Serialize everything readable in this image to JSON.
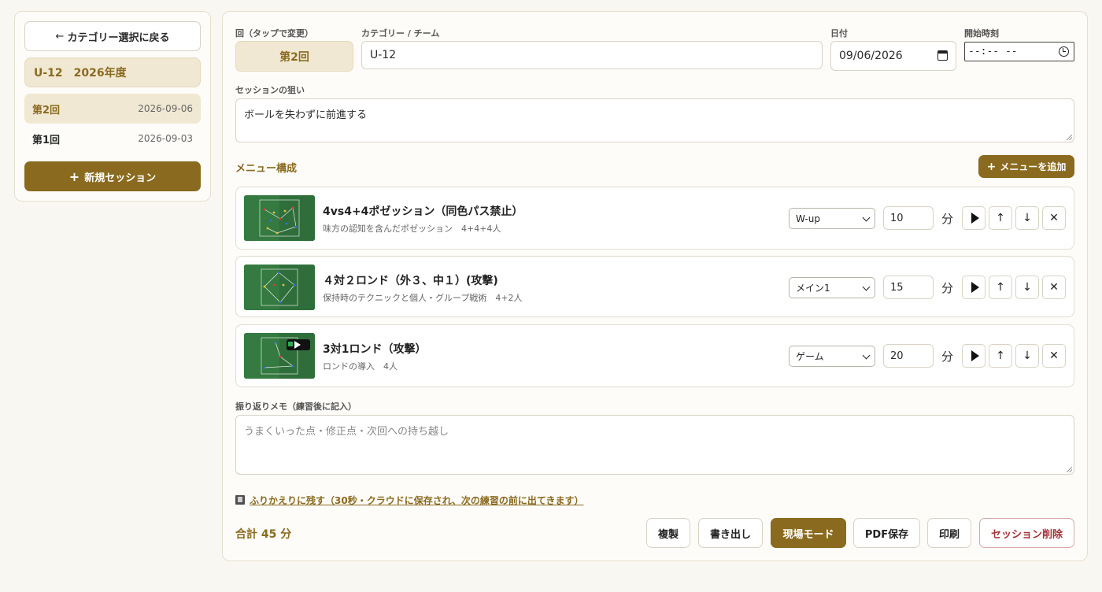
{
  "sidebar": {
    "back_label": "カテゴリー選択に戻る",
    "category_title": "U-12　2026年度",
    "sessions": [
      {
        "label": "第2回",
        "date": "2026-09-06"
      },
      {
        "label": "第1回",
        "date": "2026-09-03"
      }
    ],
    "new_session_label": "新規セッション"
  },
  "form": {
    "round_label": "回（タップで変更）",
    "round_value": "第2回",
    "category_label": "カテゴリー / チーム",
    "category_value": "U-12",
    "date_label": "日付",
    "date_value": "09/06/2026",
    "time_label": "開始時刻",
    "time_value": "--:-- --",
    "aim_label": "セッションの狙い",
    "aim_value": "ボールを失わずに前進する"
  },
  "menu": {
    "section_title": "メニュー構成",
    "add_label": "メニューを追加",
    "minutes_unit": "分",
    "items": [
      {
        "title": "4vs4+4ポゼッション（同色パス禁止）",
        "subtitle": "味方の認知を含んだポゼッション　4+4+4人",
        "phase": "W-up",
        "minutes": "10"
      },
      {
        "title": "４対２ロンド（外３、中１）(攻撃)",
        "subtitle": "保持時のテクニックと個人・グループ戦術　4+2人",
        "phase": "メイン1",
        "minutes": "15"
      },
      {
        "title": "3対1ロンド（攻撃）",
        "subtitle": "ロンドの導入　4人",
        "phase": "ゲーム",
        "minutes": "20"
      }
    ]
  },
  "reflection": {
    "label": "振り返りメモ（練習後に記入）",
    "placeholder": "うまくいった点・修正点・次回への持ち越し"
  },
  "save_link": "ふりかえりに残す（30秒・クラウドに保存され、次の練習の前に出てきます）",
  "footer": {
    "total": "合計 45 分",
    "duplicate": "複製",
    "export": "書き出し",
    "field_mode": "現場モード",
    "pdf": "PDF保存",
    "print": "印刷",
    "delete": "セッション削除"
  },
  "colors": {
    "accent": "#8a6a1f",
    "accent_light": "#f1e8d3",
    "danger": "#a3343a",
    "pitch": "#2f6e3b"
  }
}
